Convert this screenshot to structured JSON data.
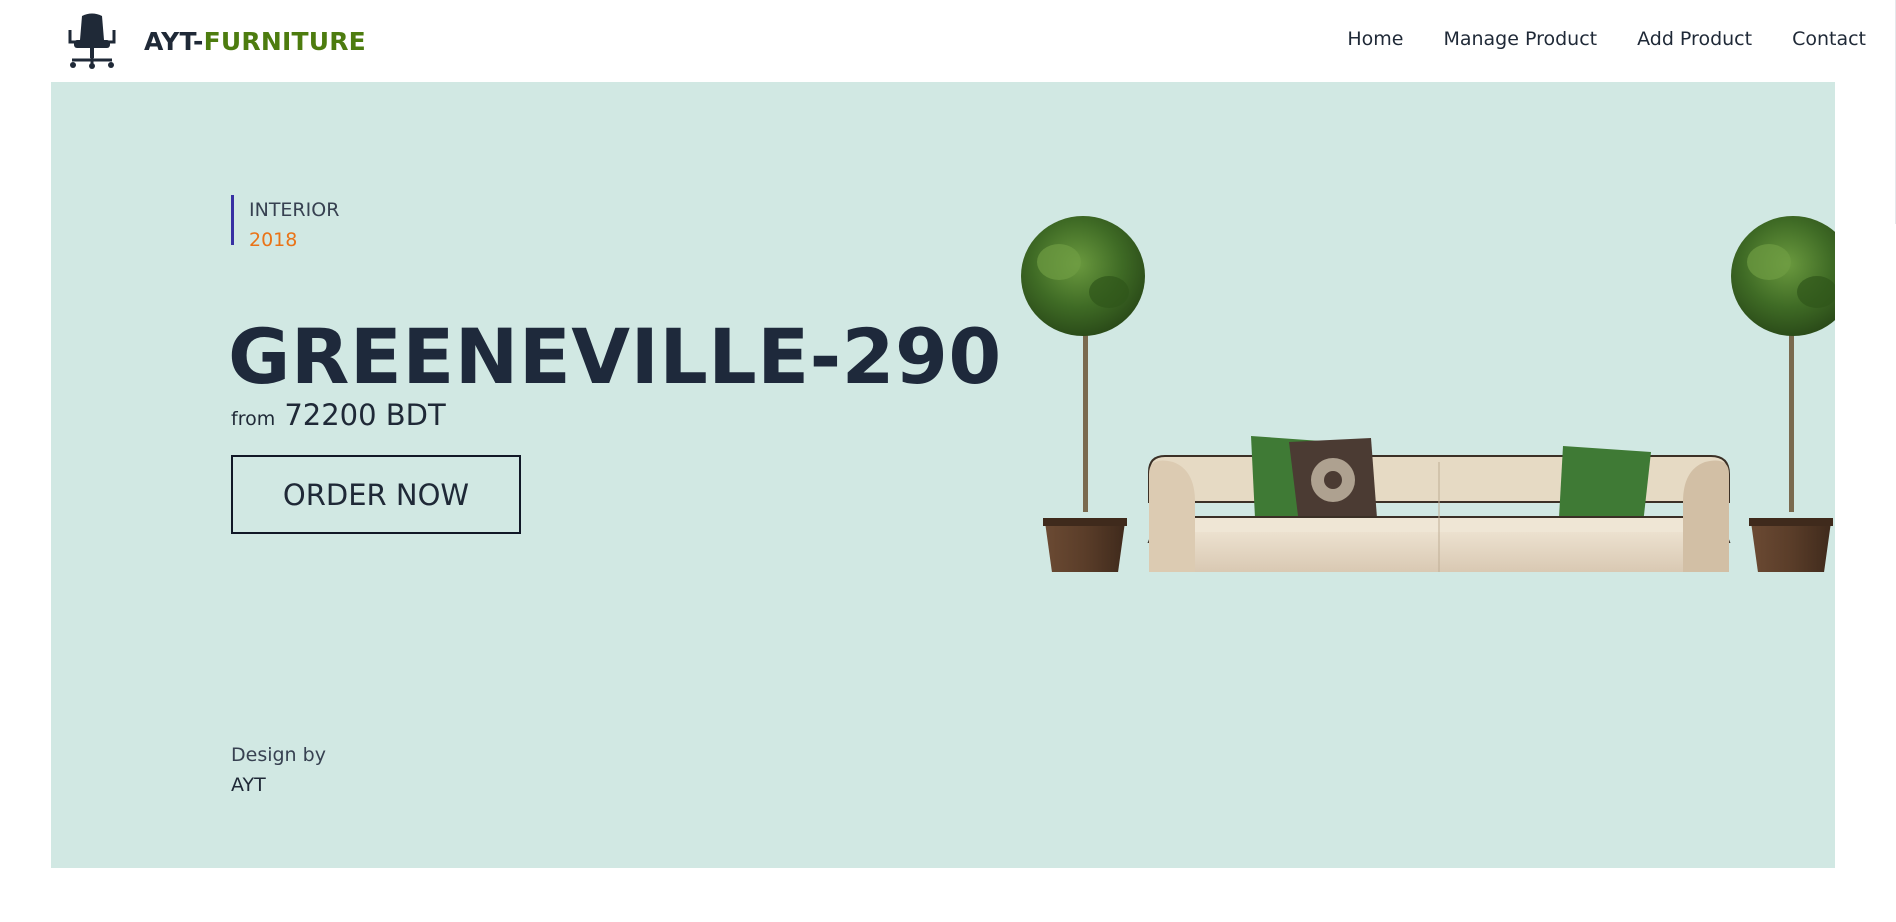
{
  "brand": {
    "prefix": "AYT-",
    "accent": "FURNITURE",
    "accent_color": "#4d7c0f",
    "logo_icon": "office-chair-icon"
  },
  "nav": {
    "items": [
      {
        "label": "Home"
      },
      {
        "label": "Manage Product"
      },
      {
        "label": "Add Product"
      },
      {
        "label": "Contact"
      }
    ]
  },
  "hero": {
    "background_color": "#d1e8e3",
    "tag": "INTERIOR",
    "year": "2018",
    "year_color": "#ea7317",
    "tag_border_color": "#3730a3",
    "title": "GREENEVILLE-290",
    "price_prefix": "from",
    "price": "72200 BDT",
    "cta_label": "ORDER NOW",
    "credit_label": "Design by",
    "credit_name": "AYT",
    "image": "sofa-with-potted-trees"
  }
}
